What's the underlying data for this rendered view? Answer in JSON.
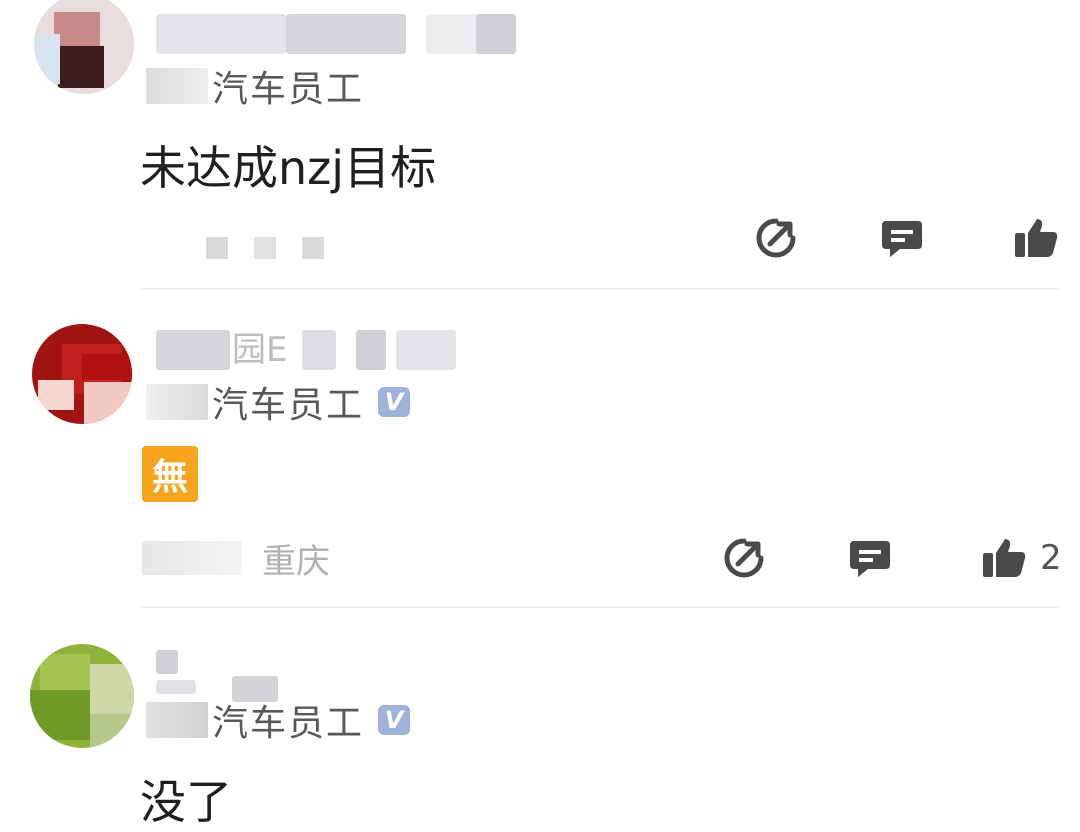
{
  "comments": [
    {
      "affiliation": "汽车员工",
      "verified": false,
      "text": "未达成nzj目标",
      "location": "",
      "likes": ""
    },
    {
      "name_partial": "园E",
      "affiliation": "汽车员工",
      "verified": true,
      "sticker": "無",
      "location": "重庆",
      "likes": "2"
    },
    {
      "affiliation": "汽车员工",
      "verified": true,
      "text": "没了"
    }
  ],
  "badge_letter": "V",
  "colors": {
    "icon": "#4a4a4a",
    "badge": "#9fb3d8",
    "sticker": "#f7a41d"
  },
  "icons": [
    "share-icon",
    "comment-icon",
    "like-icon"
  ]
}
